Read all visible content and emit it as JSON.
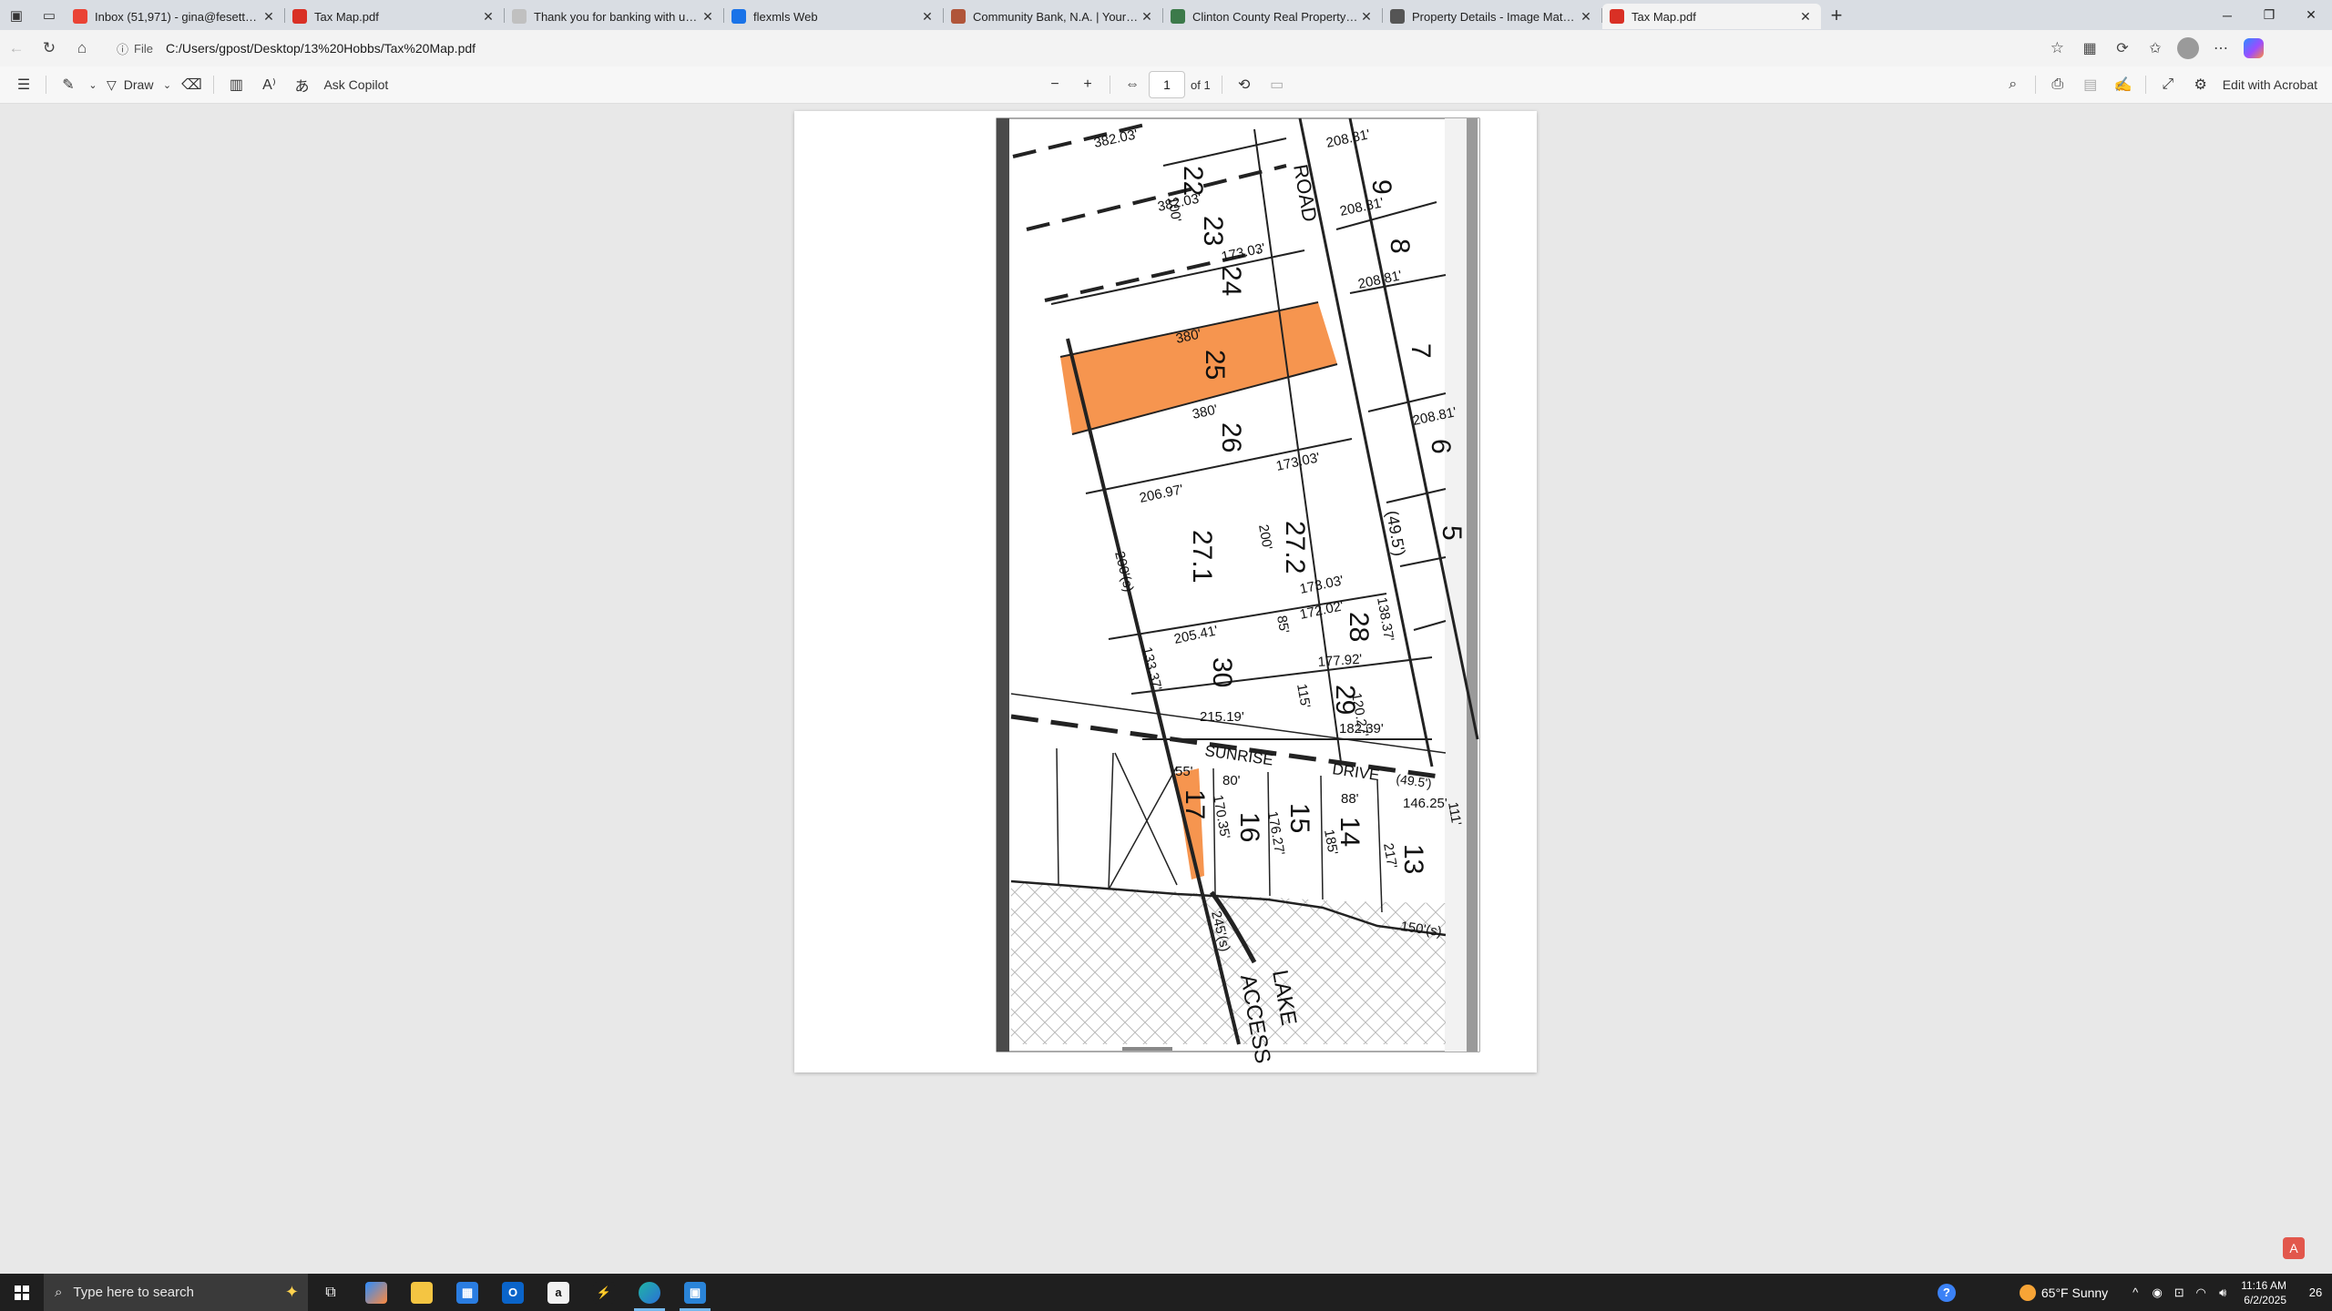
{
  "tabs": [
    {
      "title": "Inbox (51,971) - gina@fesettereal",
      "favicon": "gmail-icon",
      "color": "#ea4335",
      "active": false
    },
    {
      "title": "Tax Map.pdf",
      "favicon": "pdf-icon",
      "color": "#d93025",
      "active": false
    },
    {
      "title": "Thank you for banking with us. |",
      "favicon": "bank-icon",
      "color": "#c0c0c0",
      "active": false
    },
    {
      "title": "flexmls Web",
      "favicon": "flexmls-icon",
      "color": "#1a73e8",
      "active": false
    },
    {
      "title": "Community Bank, N.A. | Your Trus",
      "favicon": "community-bank-icon",
      "color": "#b0553a",
      "active": false
    },
    {
      "title": "Clinton County Real Property Offi",
      "favicon": "county-icon",
      "color": "#3c7a4a",
      "active": false
    },
    {
      "title": "Property Details - Image Mate O",
      "favicon": "globe-icon",
      "color": "#555555",
      "active": false
    },
    {
      "title": "Tax Map.pdf",
      "favicon": "pdf-icon",
      "color": "#d93025",
      "active": true
    }
  ],
  "address": {
    "label": "File",
    "url": "C:/Users/gpost/Desktop/13%20Hobbs/Tax%20Map.pdf"
  },
  "pdf_toolbar": {
    "draw_label": "Draw",
    "ask_copilot_label": "Ask Copilot",
    "page_number": "1",
    "page_total": "of 1",
    "edit_label": "Edit with Acrobat"
  },
  "map": {
    "road_label": "ROAD",
    "road_width": "(49.5')",
    "drive_label": "SUNRISE",
    "drive_label2": "DRIVE",
    "drive_width": "(49.5')",
    "lake_label": "LAKE",
    "lake_label2": "ACCESS",
    "lots": [
      "22",
      "23",
      "24",
      "25",
      "26",
      "27.1",
      "27.2",
      "28",
      "29",
      "30",
      "9",
      "8",
      "7",
      "6",
      "5",
      "17",
      "16",
      "15",
      "14",
      "13"
    ],
    "dims": [
      "382.03'",
      "382.03'",
      "173.03'",
      "380'",
      "380'",
      "173.03'",
      "206.97'",
      "200'",
      "205.41'",
      "173.03'",
      "172.02'",
      "177.92'",
      "138.37'",
      "215.19'",
      "182.39'",
      "120.27'",
      "200'(s)",
      "133.37'",
      "208.81'",
      "208.81'",
      "208.81'",
      "208.81'",
      "170.35'",
      "176.27'",
      "146.25'",
      "150'(s)",
      "245'(s)",
      "100'",
      "80'",
      "88'",
      "185'",
      "217'",
      "55'",
      "85'",
      "115'",
      "111'"
    ],
    "highlight_color": "#f58a3c"
  },
  "taskbar": {
    "search_placeholder": "Type here to search",
    "weather": "65°F  Sunny",
    "time": "11:16 AM",
    "date": "6/2/2025",
    "notif_count": "26"
  }
}
